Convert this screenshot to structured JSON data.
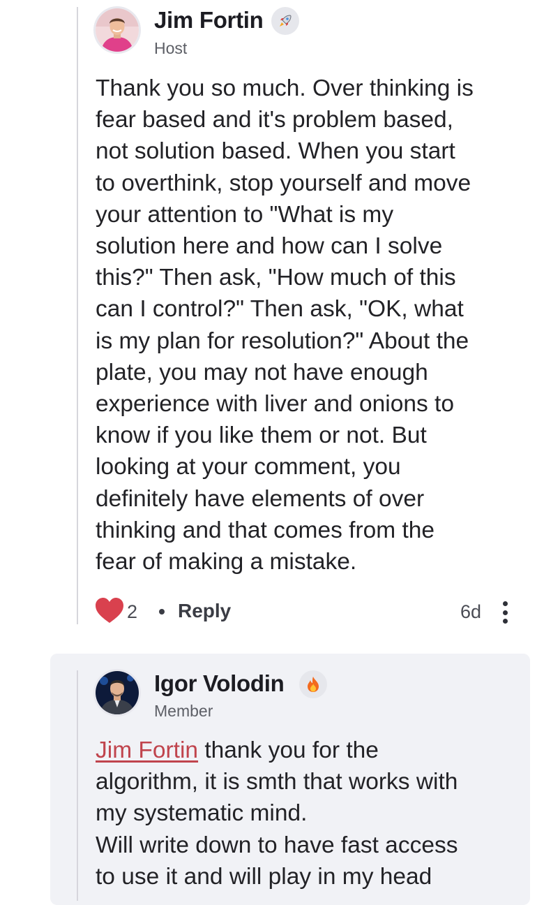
{
  "comment": {
    "author": {
      "name": "Jim Fortin",
      "role": "Host",
      "badge_icon": "rocket-icon"
    },
    "body": "Thank you so much. Over thinking is\nfear based and it's problem based,\nnot solution based. When you start\nto overthink, stop yourself and move\nyour attention to \"What is my\nsolution here and how can I solve\nthis?\" Then ask, \"How much of this\ncan I control?\" Then ask, \"OK, what\nis my plan for resolution?\" About the\nplate, you may not have enough\nexperience with liver and onions to\nknow if you like them or not. But\nlooking at your comment, you\ndefinitely have elements of over\nthinking and that comes from the\nfear of making a mistake.",
    "likes": "2",
    "reply_label": "Reply",
    "time_ago": "6d"
  },
  "reply": {
    "author": {
      "name": "Igor Volodin",
      "role": "Member",
      "badge_icon": "fire-icon"
    },
    "mention": "Jim Fortin",
    "body_after_mention": " thank you for the\nalgorithm, it is smth that works with\nmy systematic mind.\nWill write down to have fast access\nto use it and will play in my head"
  },
  "colors": {
    "like_heart": "#d9414e",
    "mention": "#c0444d",
    "reply_background": "#f1f2f6",
    "thread_line": "#d6d6dc"
  }
}
